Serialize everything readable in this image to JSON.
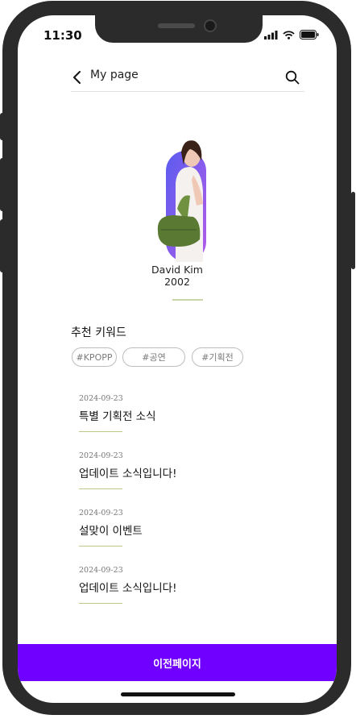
{
  "status_bar": {
    "time": "11:30"
  },
  "header": {
    "title": "My page"
  },
  "profile": {
    "name": "David Kim",
    "year": "2002"
  },
  "keywords": {
    "title": "추천 키워드",
    "tags": [
      "#KPOPP",
      "#공연",
      "#기획전"
    ]
  },
  "news": [
    {
      "date": "2024-09-23",
      "title": "특별 기획전 소식"
    },
    {
      "date": "2024-09-23",
      "title": "업데이트 소식입니다!"
    },
    {
      "date": "2024-09-23",
      "title": "설맞이 이벤트"
    },
    {
      "date": "2024-09-23",
      "title": "업데이트 소식입니다!"
    }
  ],
  "footer": {
    "prev_label": "이전페이지"
  },
  "colors": {
    "accent": "#7000ff",
    "divider": "#c9d4a8"
  }
}
